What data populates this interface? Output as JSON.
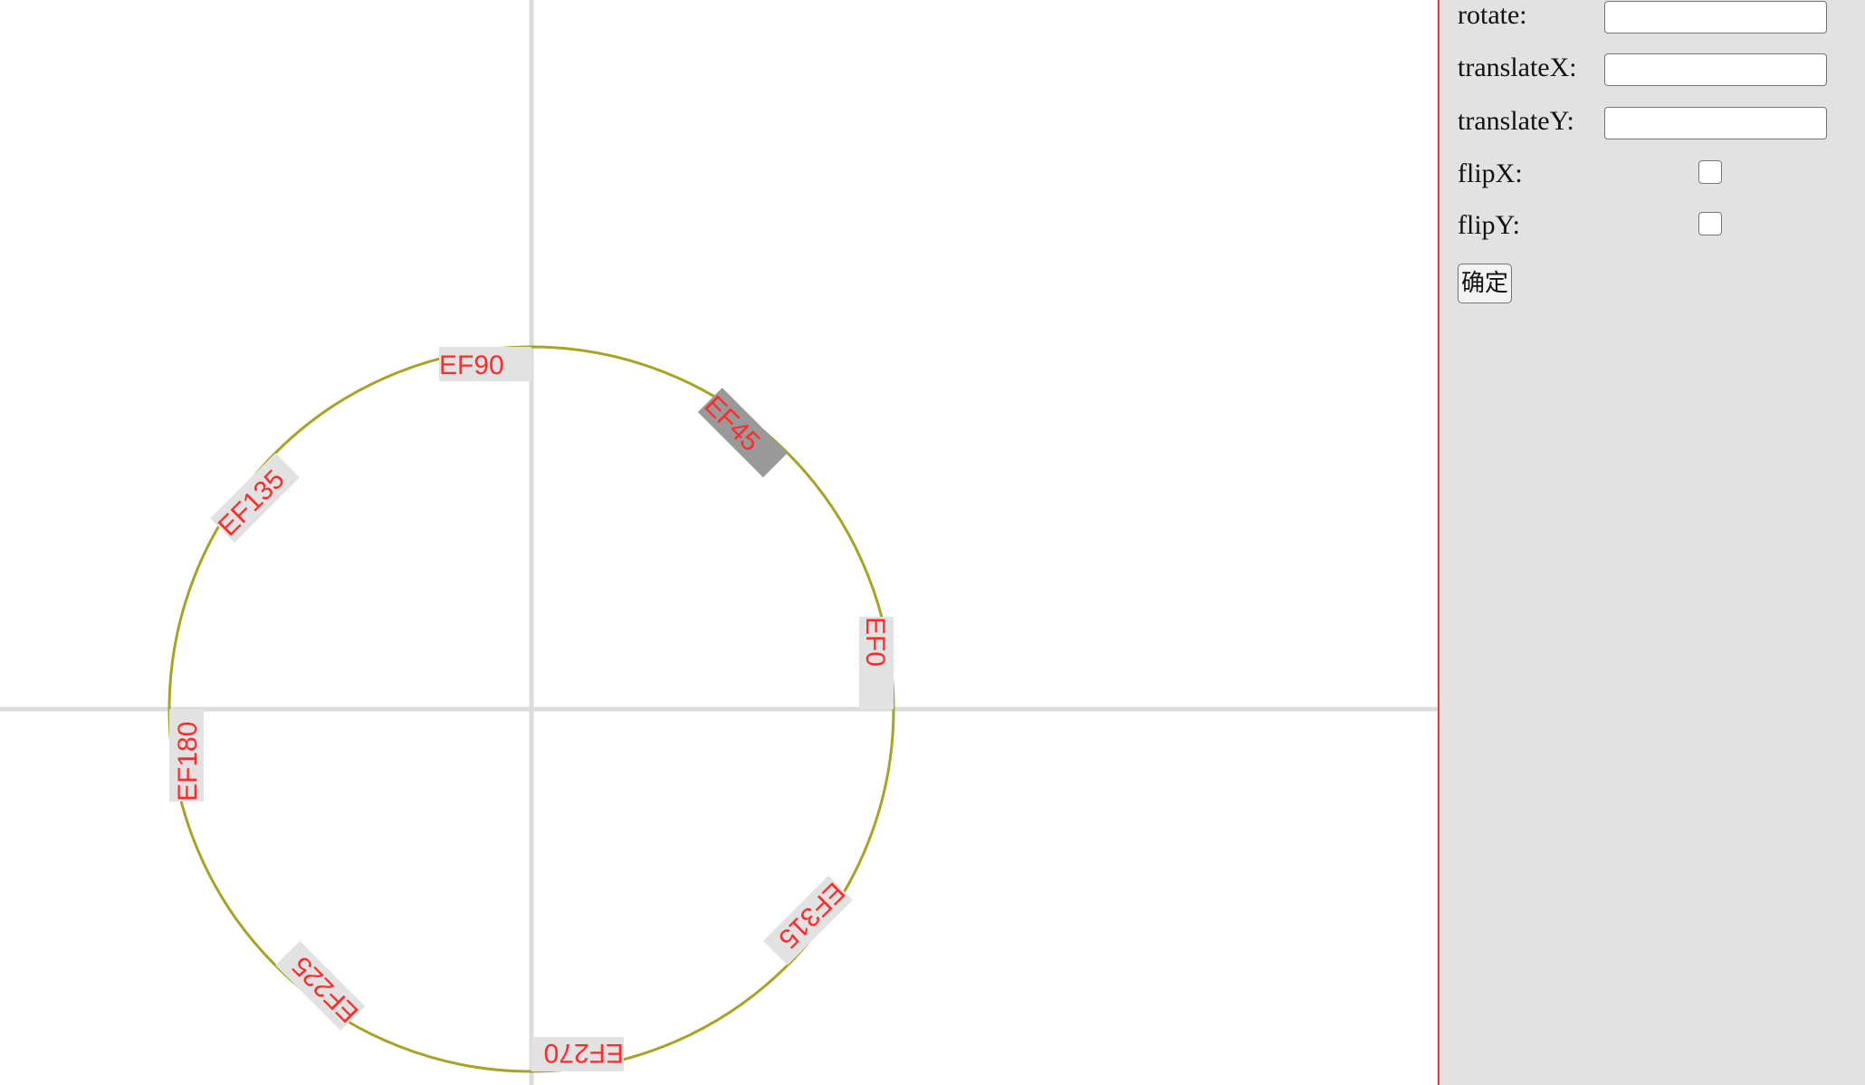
{
  "canvas": {
    "axis_color": "#dcdcdc",
    "circle_color": "#a8a322",
    "label_text_color": "#ff2a2a",
    "label_bg_color": "#e2e2e2",
    "selected_label_bg_color": "#999999",
    "labels": [
      {
        "text": "EF0",
        "angle": 0,
        "selected": false
      },
      {
        "text": "EF45",
        "angle": 45,
        "selected": true
      },
      {
        "text": "EF90",
        "angle": 90,
        "selected": false
      },
      {
        "text": "EF135",
        "angle": 135,
        "selected": false
      },
      {
        "text": "EF180",
        "angle": 180,
        "selected": false
      },
      {
        "text": "EF225",
        "angle": 225,
        "selected": false
      },
      {
        "text": "EF270",
        "angle": 270,
        "selected": false
      },
      {
        "text": "EF315",
        "angle": 315,
        "selected": false
      }
    ]
  },
  "panel": {
    "accent_border_color": "#e23b3b",
    "rotate_label": "rotate:",
    "rotate_value": "",
    "translate_x_label": "translateX:",
    "translate_x_value": "",
    "translate_y_label": "translateY:",
    "translate_y_value": "",
    "flip_x_label": "flipX:",
    "flip_x_checked": false,
    "flip_y_label": "flipY:",
    "flip_y_checked": false,
    "confirm_label": "确定"
  }
}
